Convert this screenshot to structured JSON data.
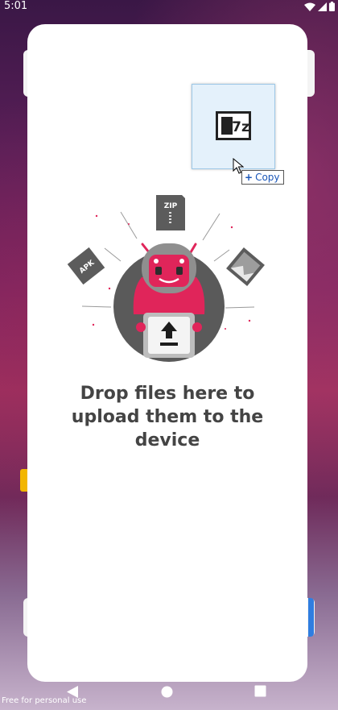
{
  "status_bar": {
    "time": "5:01",
    "icons": [
      "wifi-icon",
      "signal-icon",
      "battery-icon"
    ]
  },
  "drop_zone": {
    "lines": [
      "Drop files here to",
      "upload them to the",
      "device"
    ],
    "illustration": {
      "badges": {
        "zip": "ZIP",
        "apk": "APK"
      },
      "icons": [
        "zip-file-icon",
        "apk-file-icon",
        "image-file-icon",
        "upload-arrow-icon",
        "robot-mascot"
      ]
    }
  },
  "drag_overlay": {
    "file_icon_label": "7z",
    "action_label": "Copy",
    "action_symbol": "+"
  },
  "nav_bar": {
    "buttons": [
      "back-icon",
      "home-icon",
      "recents-icon"
    ]
  },
  "watermark": "Free for personal use",
  "colors": {
    "accent": "#e0255a",
    "robot_gray": "#8f8f8f",
    "dark_gray": "#555555",
    "text": "#444444",
    "ghost_bg": "#e4f1fb",
    "copy_blue": "#1a56b8"
  }
}
